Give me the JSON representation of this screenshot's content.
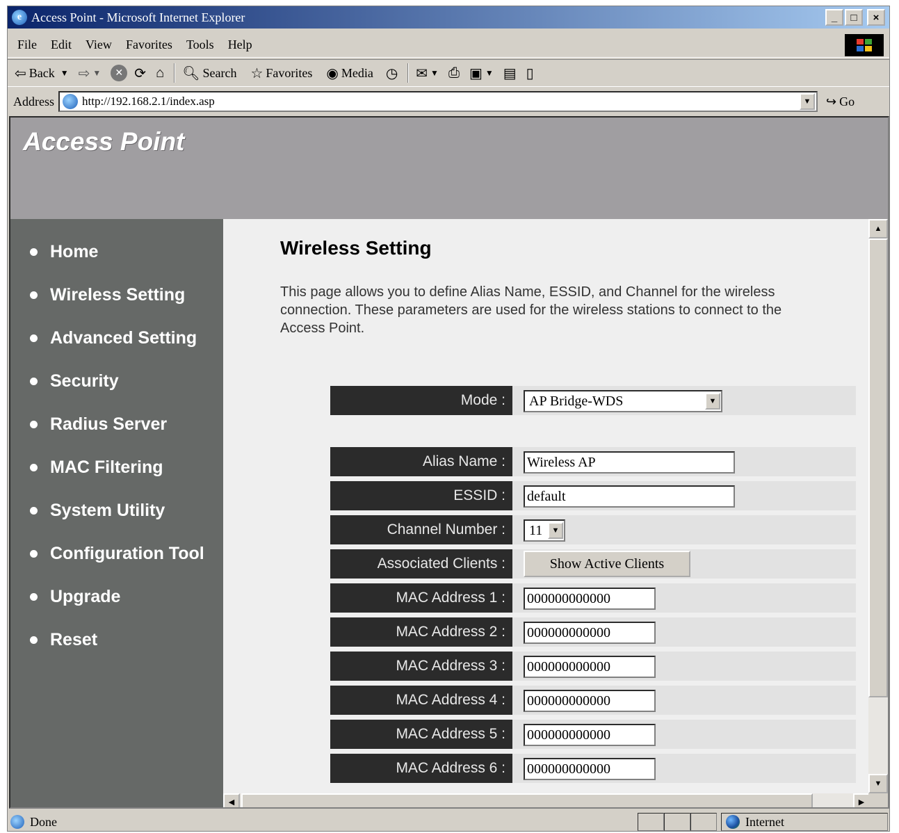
{
  "window": {
    "title": "Access Point - Microsoft Internet Explorer",
    "minimize": "_",
    "maximize": "□",
    "close": "×"
  },
  "menu": [
    "File",
    "Edit",
    "View",
    "Favorites",
    "Tools",
    "Help"
  ],
  "toolbar": {
    "back": "Back",
    "forward_icon": "forward-arrow-icon",
    "search": "Search",
    "favorites": "Favorites",
    "media": "Media"
  },
  "address": {
    "label": "Address",
    "url": "http://192.168.2.1/index.asp",
    "go": "Go"
  },
  "page": {
    "brand": "Access Point",
    "nav": [
      "Home",
      "Wireless Setting",
      "Advanced Setting",
      "Security",
      "Radius Server",
      "MAC Filtering",
      "System Utility",
      "Configuration Tool",
      "Upgrade",
      "Reset"
    ],
    "heading": "Wireless Setting",
    "description": "This page allows you to define Alias Name, ESSID, and Channel for the wireless connection. These parameters are used for the wireless stations to connect to the Access Point.",
    "form": {
      "mode_label": "Mode :",
      "mode_value": "AP Bridge-WDS",
      "alias_label": "Alias Name :",
      "alias_value": "Wireless AP",
      "essid_label": "ESSID :",
      "essid_value": "default",
      "channel_label": "Channel Number :",
      "channel_value": "11",
      "clients_label": "Associated Clients :",
      "clients_button": "Show Active Clients",
      "mac": [
        {
          "label": "MAC Address 1 :",
          "value": "000000000000"
        },
        {
          "label": "MAC Address 2 :",
          "value": "000000000000"
        },
        {
          "label": "MAC Address 3 :",
          "value": "000000000000"
        },
        {
          "label": "MAC Address 4 :",
          "value": "000000000000"
        },
        {
          "label": "MAC Address 5 :",
          "value": "000000000000"
        },
        {
          "label": "MAC Address 6 :",
          "value": "000000000000"
        }
      ]
    }
  },
  "status": {
    "text": "Done",
    "zone": "Internet"
  },
  "colors": {
    "header": "#a09ea1",
    "sidebar": "#666967",
    "label_bg": "#2b2b2b",
    "content_bg": "#efefef"
  }
}
